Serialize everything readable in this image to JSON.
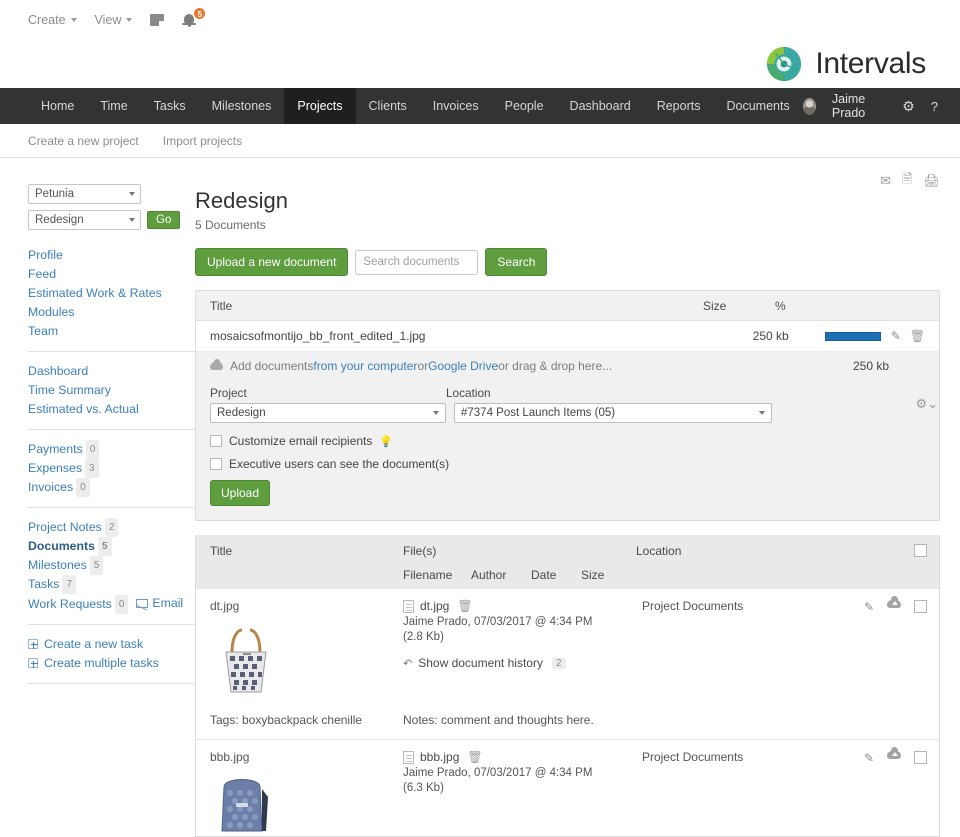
{
  "topbar": {
    "create_label": "Create",
    "view_label": "View",
    "note_icon": "note-icon",
    "bell_icon": "bell-icon",
    "notification_count": "5"
  },
  "brand": {
    "name": "Intervals",
    "logo_icon": "intervals-logo-icon"
  },
  "mainnav": {
    "items": [
      {
        "label": "Home",
        "active": false
      },
      {
        "label": "Time",
        "active": false
      },
      {
        "label": "Tasks",
        "active": false
      },
      {
        "label": "Milestones",
        "active": false
      },
      {
        "label": "Projects",
        "active": true
      },
      {
        "label": "Clients",
        "active": false
      },
      {
        "label": "Invoices",
        "active": false
      },
      {
        "label": "People",
        "active": false
      },
      {
        "label": "Dashboard",
        "active": false
      },
      {
        "label": "Reports",
        "active": false
      },
      {
        "label": "Documents",
        "active": false
      }
    ],
    "user": "Jaime Prado",
    "gear_icon": "gear-icon",
    "help_icon": "help-icon"
  },
  "subnav": {
    "items": [
      "Create a new project",
      "Import projects"
    ]
  },
  "sidebar": {
    "client_select": "Petunia",
    "project_select": "Redesign",
    "go_label": "Go",
    "group1": [
      {
        "label": "Profile"
      },
      {
        "label": "Feed"
      },
      {
        "label": "Estimated Work & Rates"
      },
      {
        "label": "Modules"
      },
      {
        "label": "Team"
      }
    ],
    "group2": [
      {
        "label": "Dashboard"
      },
      {
        "label": "Time Summary"
      },
      {
        "label": "Estimated vs. Actual"
      }
    ],
    "group3": [
      {
        "label": "Payments",
        "count": "0"
      },
      {
        "label": "Expenses",
        "count": "3"
      },
      {
        "label": "Invoices",
        "count": "0"
      }
    ],
    "group4": [
      {
        "label": "Project Notes",
        "count": "2",
        "bold": false
      },
      {
        "label": "Documents",
        "count": "5",
        "bold": true
      },
      {
        "label": "Milestones",
        "count": "5",
        "bold": false
      },
      {
        "label": "Tasks",
        "count": "7",
        "bold": false
      },
      {
        "label": "Work Requests",
        "count": "0",
        "bold": false
      }
    ],
    "email_label": "Email",
    "group5": [
      {
        "label": "Create a new task"
      },
      {
        "label": "Create multiple tasks"
      }
    ]
  },
  "header": {
    "title": "Redesign",
    "doc_count": "5 Documents",
    "upload_button": "Upload a new document",
    "search_placeholder": "Search documents",
    "search_value": "",
    "search_button": "Search",
    "email_icon": "email-icon",
    "pdf_icon": "pdf-icon",
    "print_icon": "print-icon",
    "settings_icon": "gear-icon"
  },
  "upload_panel": {
    "headers": {
      "title": "Title",
      "size": "Size",
      "percent": "%"
    },
    "queued": {
      "name": "mosaicsofmontijo_bb_front_edited_1.jpg",
      "size": "250 kb",
      "progress": 100
    },
    "dropzone": {
      "prefix": "Add documents ",
      "link1": "from your computer",
      "mid": " or ",
      "link2": "Google Drive",
      "suffix": " or drag & drop here...",
      "size": "250 kb",
      "icon": "cloud-upload-icon"
    },
    "project_label": "Project",
    "location_label": "Location",
    "project_value": "Redesign",
    "location_value": "#7374 Post Launch Items (05)",
    "checkbox1": "Customize email recipients",
    "checkbox2": "Executive users can see the document(s)",
    "upload_label": "Upload"
  },
  "doc_table": {
    "headers_row1": {
      "title": "Title",
      "files": "File(s)",
      "location": "Location"
    },
    "headers_row2": {
      "filename": "Filename",
      "author": "Author",
      "date": "Date",
      "size": "Size"
    },
    "rows": [
      {
        "title": "dt.jpg",
        "filename": "dt.jpg",
        "meta": "Jaime Prado, 07/03/2017 @ 4:34 PM",
        "filesize": "(2.8 Kb)",
        "history_label": "Show document history",
        "history_count": "2",
        "location": "Project Documents",
        "tags_label": "Tags:",
        "tags_value": "boxybackpack chenille",
        "notes_label": "Notes:",
        "notes_value": "comment and thoughts here.",
        "thumb": "tote-bag-thumbnail"
      },
      {
        "title": "bbb.jpg",
        "filename": "bbb.jpg",
        "meta": "Jaime Prado, 07/03/2017 @ 4:34 PM",
        "filesize": "(6.3 Kb)",
        "location": "Project Documents",
        "thumb": "backpack-thumbnail"
      }
    ]
  },
  "colors": {
    "green": "#5f9e3e",
    "nav_dark": "#333333",
    "nav_active": "#1f1f1f",
    "link_blue": "#3c7fb9",
    "progress_blue": "#1a6fb5",
    "badge_orange": "#e8762c"
  }
}
